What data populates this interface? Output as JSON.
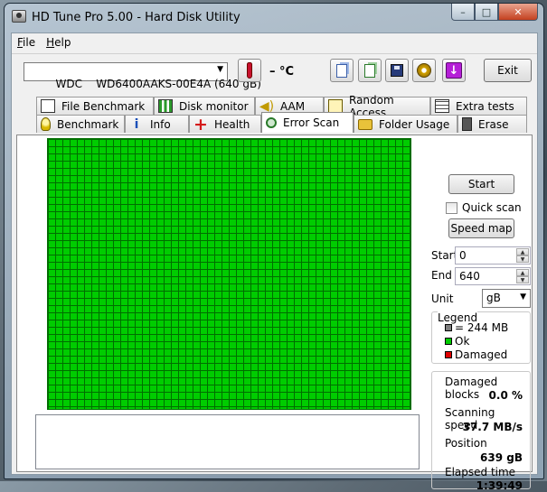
{
  "window": {
    "title": "HD Tune Pro 5.00 - Hard Disk Utility",
    "min": "–",
    "max": "□",
    "close": "✕"
  },
  "menu": {
    "file_first": "F",
    "file_rest": "ile",
    "help_first": "H",
    "help_rest": "elp"
  },
  "toolbar": {
    "drive": "WDC    WD6400AAKS-00E4A (640 gB)",
    "temperature": "– °C",
    "exit_label": "Exit"
  },
  "tabs": {
    "row1": [
      {
        "label": "File Benchmark",
        "icon": "file-benchmark-icon"
      },
      {
        "label": "Disk monitor",
        "icon": "disk-monitor-icon"
      },
      {
        "label": "AAM",
        "icon": "speaker-icon"
      },
      {
        "label": "Random Access",
        "icon": "random-access-icon"
      },
      {
        "label": "Extra tests",
        "icon": "extra-tests-icon"
      }
    ],
    "row2": [
      {
        "label": "Benchmark",
        "icon": "bulb-icon"
      },
      {
        "label": "Info",
        "icon": "info-icon"
      },
      {
        "label": "Health",
        "icon": "health-plus-icon"
      },
      {
        "label": "Error Scan",
        "icon": "magnifier-icon"
      },
      {
        "label": "Folder Usage",
        "icon": "folder-icon"
      },
      {
        "label": "Erase",
        "icon": "trash-icon"
      }
    ],
    "active": "Error Scan"
  },
  "scan": {
    "start_label": "Start",
    "quick_scan_label": "Quick scan",
    "quick_scan_checked": false,
    "speed_map_label": "Speed map",
    "start_field_label": "Start",
    "start_value": "0",
    "end_field_label": "End",
    "end_value": "640",
    "unit_label": "Unit",
    "unit_value": "gB",
    "legend": {
      "title": "Legend",
      "block_size": "= 244 MB",
      "ok": "Ok",
      "damaged": "Damaged",
      "colors": {
        "block": "#7f7f7f",
        "ok": "#00cc00",
        "damaged": "#e00000"
      }
    },
    "stats": {
      "damaged_blocks_label": "Damaged blocks",
      "damaged_blocks_value": "0.0 %",
      "scanning_speed_label": "Scanning speed",
      "scanning_speed_value": "37.7 MB/s",
      "position_label": "Position",
      "position_value": "639 gB",
      "elapsed_label": "Elapsed time",
      "elapsed_value": "1:39:49"
    }
  },
  "colors": {
    "ok_block": "#00cc00",
    "grid_line": "#006e00"
  }
}
